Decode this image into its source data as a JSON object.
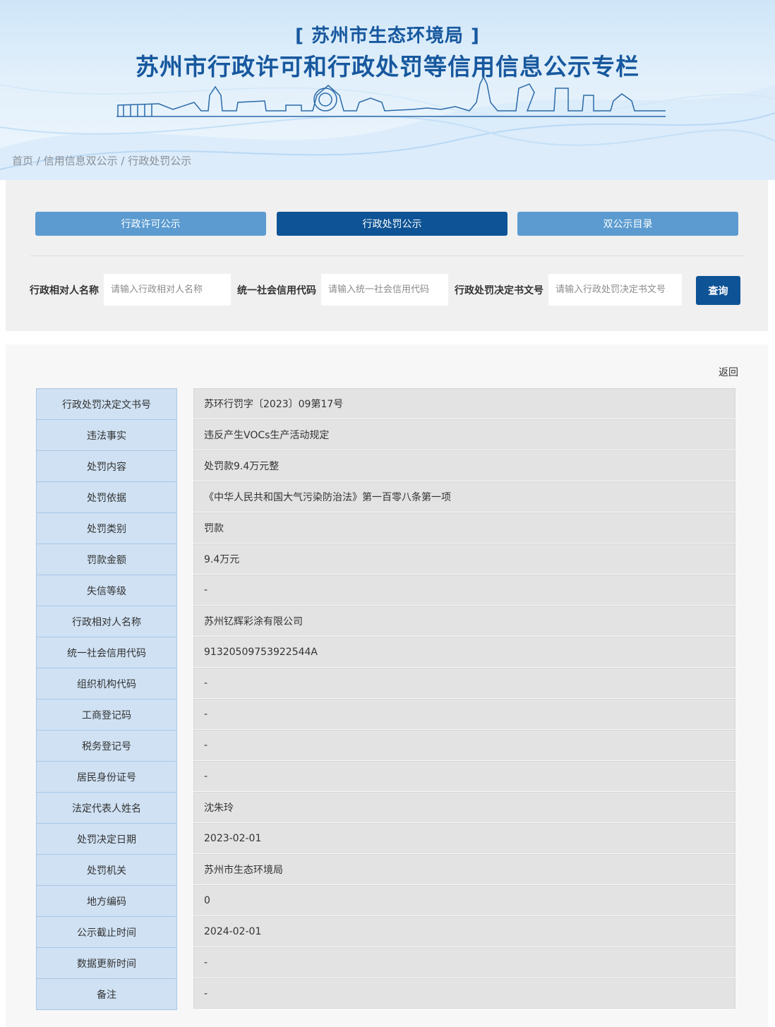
{
  "banner": {
    "subtitle": "[ 苏州市生态环境局 ]",
    "title": "苏州市行政许可和行政处罚等信用信息公示专栏"
  },
  "breadcrumb": {
    "home": "首页",
    "sep": " / ",
    "level2": "信用信息双公示",
    "level3": "行政处罚公示"
  },
  "tabs": {
    "permit": "行政许可公示",
    "penalty": "行政处罚公示",
    "catalog": "双公示目录"
  },
  "search": {
    "name_label": "行政相对人名称",
    "name_placeholder": "请输入行政相对人名称",
    "code_label": "统一社会信用代码",
    "code_placeholder": "请输入统一社会信用代码",
    "doc_label": "行政处罚决定书文号",
    "doc_placeholder": "请输入行政处罚决定书文号",
    "submit": "查询"
  },
  "back": "返回",
  "details": [
    {
      "key": "行政处罚决定文书号",
      "value": "苏环行罚字〔2023〕09第17号"
    },
    {
      "key": "违法事实",
      "value": "违反产生VOCs生产活动规定"
    },
    {
      "key": "处罚内容",
      "value": "处罚款9.4万元整"
    },
    {
      "key": "处罚依据",
      "value": "《中华人民共和国大气污染防治法》第一百零八条第一项"
    },
    {
      "key": "处罚类别",
      "value": "罚款"
    },
    {
      "key": "罚款金额",
      "value": "9.4万元"
    },
    {
      "key": "失信等级",
      "value": "-"
    },
    {
      "key": "行政相对人名称",
      "value": "苏州钇辉彩涂有限公司"
    },
    {
      "key": "统一社会信用代码",
      "value": "91320509753922544A"
    },
    {
      "key": "组织机构代码",
      "value": "-"
    },
    {
      "key": "工商登记码",
      "value": "-"
    },
    {
      "key": "税务登记号",
      "value": "-"
    },
    {
      "key": "居民身份证号",
      "value": "-"
    },
    {
      "key": "法定代表人姓名",
      "value": "沈朱玲"
    },
    {
      "key": "处罚决定日期",
      "value": "2023-02-01"
    },
    {
      "key": "处罚机关",
      "value": "苏州市生态环境局"
    },
    {
      "key": "地方编码",
      "value": "0"
    },
    {
      "key": "公示截止时间",
      "value": "2024-02-01"
    },
    {
      "key": "数据更新时间",
      "value": "-"
    },
    {
      "key": "备注",
      "value": "-"
    }
  ]
}
